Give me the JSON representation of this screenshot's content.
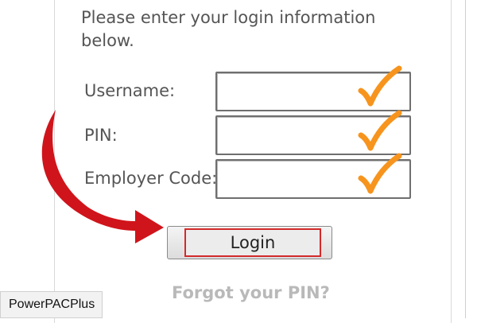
{
  "intro_text": "Please enter your login information below.",
  "form": {
    "fields": [
      {
        "label": "Username:",
        "value": ""
      },
      {
        "label": "PIN:",
        "value": ""
      },
      {
        "label": "Employer Code:",
        "value": ""
      }
    ]
  },
  "login_button": {
    "label": "Login"
  },
  "forgot_link": {
    "label": "Forgot your PIN?"
  },
  "watermark": {
    "text": "PowerPACPlus"
  },
  "colors": {
    "check": "#f7941d",
    "arrow": "#d0141b",
    "login_outline": "#d32a2a",
    "forgot_link": "#b9b9b9"
  },
  "icons": [
    "checkmark-icon",
    "curved-arrow-icon"
  ]
}
